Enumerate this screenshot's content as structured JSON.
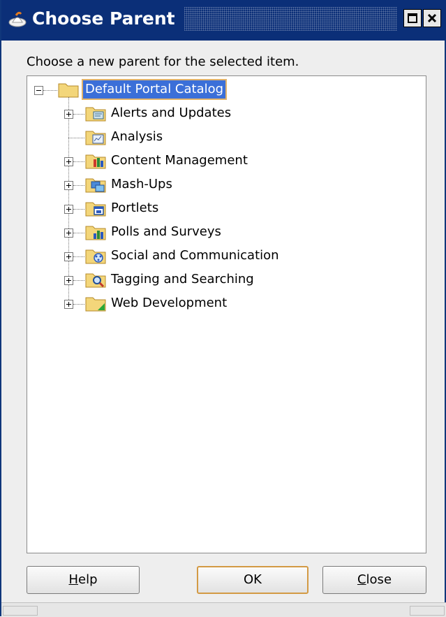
{
  "window": {
    "title": "Choose Parent",
    "message": "Choose a new parent for the selected item.",
    "colors": {
      "titlebar": "#0b2f78",
      "selection": "#3b6fd8",
      "focus_outline": "#e2b36a"
    }
  },
  "tree": {
    "root": {
      "label": "Default Portal Catalog",
      "expanded": true,
      "selected": true
    },
    "children": [
      {
        "label": "Alerts and Updates",
        "icon": "alerts-folder-icon",
        "has_children": true
      },
      {
        "label": "Analysis",
        "icon": "analysis-folder-icon",
        "has_children": false
      },
      {
        "label": "Content Management",
        "icon": "content-management-folder-icon",
        "has_children": true
      },
      {
        "label": "Mash-Ups",
        "icon": "mashups-folder-icon",
        "has_children": true
      },
      {
        "label": "Portlets",
        "icon": "portlets-folder-icon",
        "has_children": true
      },
      {
        "label": "Polls and Surveys",
        "icon": "polls-folder-icon",
        "has_children": true
      },
      {
        "label": "Social and Communication",
        "icon": "social-folder-icon",
        "has_children": true
      },
      {
        "label": "Tagging and Searching",
        "icon": "tagging-folder-icon",
        "has_children": true
      },
      {
        "label": "Web Development",
        "icon": "web-development-folder-icon",
        "has_children": true
      }
    ]
  },
  "buttons": {
    "help": {
      "mnemonic": "H",
      "rest": "elp"
    },
    "ok": "OK",
    "close": {
      "mnemonic": "C",
      "rest": "lose"
    }
  }
}
